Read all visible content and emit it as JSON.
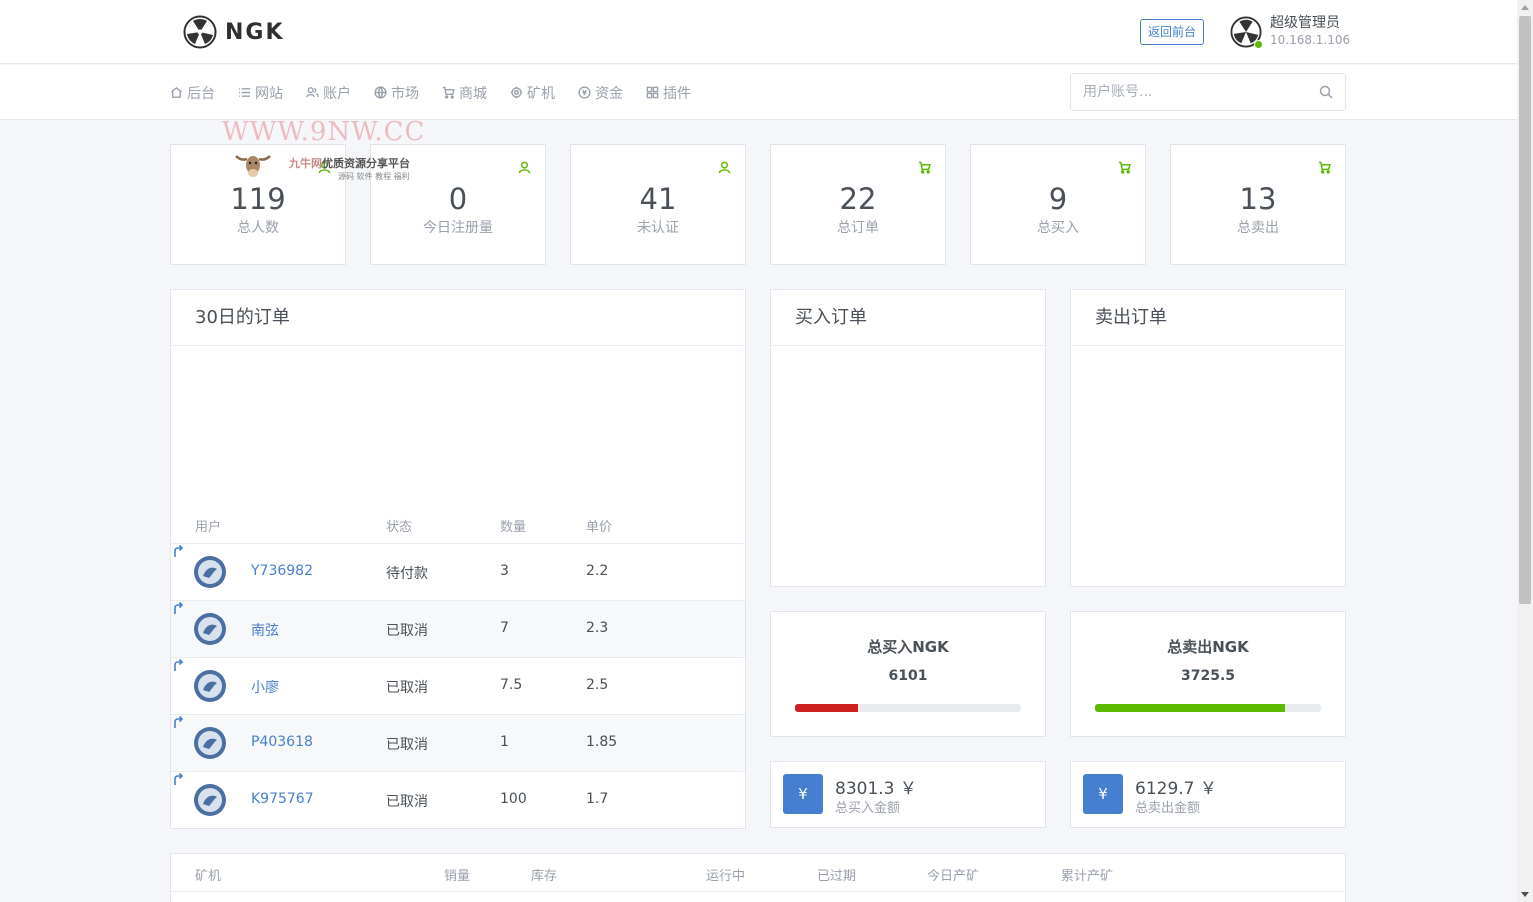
{
  "header": {
    "logo_text": "NGK",
    "back_button": "返回前台",
    "user_name": "超级管理员",
    "user_ip": "10.168.1.106"
  },
  "nav": {
    "items": [
      {
        "label": "后台",
        "icon": "home-icon"
      },
      {
        "label": "网站",
        "icon": "list-icon"
      },
      {
        "label": "账户",
        "icon": "users-icon"
      },
      {
        "label": "市场",
        "icon": "globe-icon"
      },
      {
        "label": "商城",
        "icon": "cart-icon"
      },
      {
        "label": "矿机",
        "icon": "gear-icon"
      },
      {
        "label": "资金",
        "icon": "coin-icon"
      },
      {
        "label": "插件",
        "icon": "grid-icon"
      }
    ],
    "search_placeholder": "用户账号..."
  },
  "watermark": {
    "url": "WWW.9NW.CC",
    "title_prefix": "九牛网",
    "title": "优质资源分享平台",
    "subtitle": "源码 软件 教程 福利"
  },
  "stats": [
    {
      "value": "119",
      "label": "总人数",
      "icon": "user-icon"
    },
    {
      "value": "0",
      "label": "今日注册量",
      "icon": "user-icon"
    },
    {
      "value": "41",
      "label": "未认证",
      "icon": "user-icon"
    },
    {
      "value": "22",
      "label": "总订单",
      "icon": "cart-icon"
    },
    {
      "value": "9",
      "label": "总买入",
      "icon": "cart-icon"
    },
    {
      "value": "13",
      "label": "总卖出",
      "icon": "cart-icon"
    }
  ],
  "orders": {
    "title": "30日的订单",
    "columns": [
      "用户",
      "状态",
      "数量",
      "单价"
    ],
    "rows": [
      {
        "user": "Y736982",
        "status": "待付款",
        "qty": "3",
        "price": "2.2"
      },
      {
        "user": "南弦",
        "status": "已取消",
        "qty": "7",
        "price": "2.3"
      },
      {
        "user": "小廖",
        "status": "已取消",
        "qty": "7.5",
        "price": "2.5"
      },
      {
        "user": "P403618",
        "status": "已取消",
        "qty": "1",
        "price": "1.85"
      },
      {
        "user": "K975767",
        "status": "已取消",
        "qty": "100",
        "price": "1.7"
      }
    ]
  },
  "buy_orders": {
    "title": "买入订单"
  },
  "sell_orders": {
    "title": "卖出订单"
  },
  "totals": {
    "buy": {
      "label": "总买入NGK",
      "value": "6101",
      "progress": 0.28,
      "color": "#cd201f"
    },
    "sell": {
      "label": "总卖出NGK",
      "value": "3725.5",
      "progress": 0.84,
      "color": "#5eba00"
    }
  },
  "amounts": {
    "buy": {
      "icon": "¥",
      "value": "8301.3 ￥",
      "label": "总买入金额"
    },
    "sell": {
      "icon": "¥",
      "value": "6129.7 ￥",
      "label": "总卖出金额"
    }
  },
  "miners": {
    "columns": [
      "矿机",
      "销量",
      "库存",
      "运行中",
      "已过期",
      "今日产矿",
      "累计产矿"
    ]
  },
  "colors": {
    "accent": "#467fcf",
    "success": "#5eba00",
    "danger": "#cd201f"
  }
}
